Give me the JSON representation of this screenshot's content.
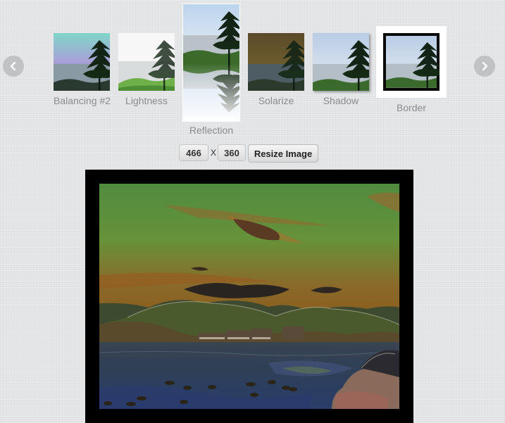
{
  "carousel": {
    "thumbnails": [
      {
        "label": "Balancing #2",
        "effect": "balancing"
      },
      {
        "label": "Lightness",
        "effect": "lightness"
      },
      {
        "label": "Reflection",
        "effect": "reflection",
        "selected": true
      },
      {
        "label": "Solarize",
        "effect": "solarize"
      },
      {
        "label": "Shadow",
        "effect": "shadow"
      },
      {
        "label": "Border",
        "effect": "border",
        "hovered": true
      }
    ],
    "prev_icon": "chevron-left-icon",
    "next_icon": "chevron-right-icon"
  },
  "resize": {
    "width": "466",
    "separator": "X",
    "height": "360",
    "button_label": "Resize Image"
  },
  "preview": {
    "applied_effect": "solarize",
    "border_color": "#000000"
  }
}
